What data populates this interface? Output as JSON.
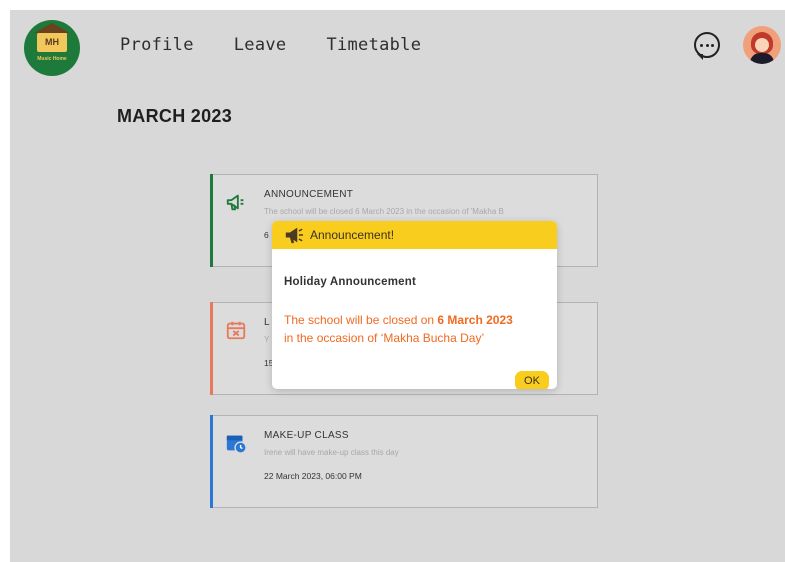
{
  "logo": {
    "text": "MH",
    "subtext": "Music Home"
  },
  "nav": {
    "items": [
      "Profile",
      "Leave",
      "Timetable"
    ]
  },
  "header": {
    "chat_icon": "chat-bubble-icon",
    "avatar_icon": "user-avatar"
  },
  "month_title": "MARCH 2023",
  "cards": [
    {
      "type": "announcement",
      "title": "ANNOUNCEMENT",
      "desc": "The school will be closed 6 March 2023 in the occasion of 'Makha B",
      "date": "6",
      "accent": "#1d7a3a",
      "icon": "megaphone-icon"
    },
    {
      "type": "leave",
      "title": "L",
      "desc": "Y",
      "date": "15",
      "accent": "#e8795c",
      "icon": "calendar-x-icon"
    },
    {
      "type": "makeup",
      "title": "MAKE-UP CLASS",
      "desc": "Irene will have make-up class this day",
      "date": "22 March 2023, 06:00 PM",
      "accent": "#2a77d6",
      "icon": "calendar-clock-icon"
    }
  ],
  "modal": {
    "header_title": "Announcement!",
    "header_icon": "megaphone-icon",
    "subtitle": "Holiday Announcement",
    "body_prefix": "The school will be closed on ",
    "body_highlight": "6 March 2023",
    "body_suffix": "in the occasion of ‘Makha Bucha Day’",
    "ok_label": "OK",
    "header_color": "#f9cd1e",
    "body_color": "#f06a22"
  }
}
